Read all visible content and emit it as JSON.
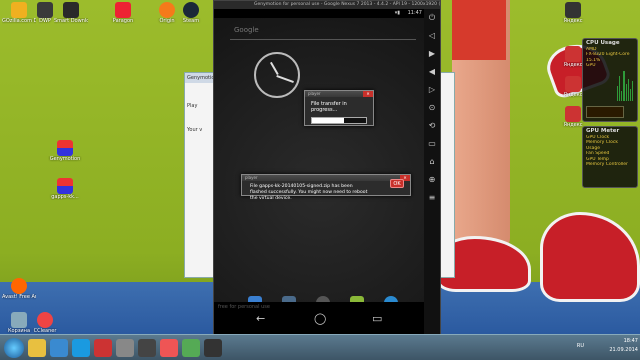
{
  "desktop": {
    "icons_left": [
      {
        "label": "GOzilla.com Download Ma...",
        "color": "#f0b020"
      },
      {
        "label": "DWP",
        "color": "#3a3a3a"
      },
      {
        "label": "Smart Download Manager",
        "color": "#2a2a2a"
      },
      {
        "label": "Paragon",
        "color": "#e23"
      },
      {
        "label": "Genymotion",
        "color": "#2a2a2a"
      },
      {
        "label": "gapps-kk...",
        "color": "#2a2a2a"
      },
      {
        "label": "gapps-kk...",
        "color": "#2a2a2a"
      },
      {
        "label": "Avast! Free Antivirus",
        "color": "#f60"
      },
      {
        "label": "Корзина",
        "color": "#8ab"
      },
      {
        "label": "CCleaner",
        "color": "#e44"
      }
    ],
    "icons_top": [
      {
        "label": "Origin",
        "color": "#f57a1a"
      },
      {
        "label": "Steam",
        "color": "#1b2838"
      }
    ],
    "icons_right": [
      {
        "label": "Яндекс",
        "color": "#333"
      },
      {
        "label": "Яндекс",
        "color": "#c33"
      },
      {
        "label": "Яндекс",
        "color": "#c33"
      },
      {
        "label": "Яндекс",
        "color": "#c33"
      }
    ]
  },
  "emulator": {
    "title": "Genymotion for personal use - Google Nexus 7 2013 - 4.4.2 - API 19 - 1200x1920 (1200x1920, 320dpi)",
    "status_time": "11:47",
    "search_placeholder": "Google",
    "watermark": "free for personal use",
    "nav": {
      "back": "←",
      "home": "◯",
      "recent": "▭"
    },
    "side_controls": [
      "⏻",
      "◁",
      "▶",
      "◀",
      "▷",
      "⊙",
      "⟲",
      "▭",
      "⌂",
      "⊕",
      "≡"
    ]
  },
  "progress_dialog": {
    "bar_title": "player",
    "message": "File transfer in progress...",
    "progress": 0.6
  },
  "done_dialog": {
    "bar_title": "player",
    "message": "File gapps-kk-20140105-signed.zip has been flashed successfully. You might now need to reboot the virtual device.",
    "ok_label": "OK"
  },
  "bg_window": {
    "title": "Genymotion",
    "play_label": "Play",
    "text": "Your v"
  },
  "gadgets": {
    "cpu": {
      "title": "CPU Usage",
      "lines": [
        "AMD",
        "FX-8320 Eight-Core",
        "15.1%",
        "GPU"
      ]
    },
    "gpu": {
      "title": "GPU Meter",
      "lines": [
        "GPU Clock",
        "Memory Clock",
        "Usage",
        "Fan Speed",
        "GPU Temp",
        "Memory Controller"
      ]
    }
  },
  "taskbar": {
    "time": "18:47",
    "date": "21.09.2014",
    "lang": "RU"
  },
  "colors": {
    "accent_red": "#c8302a",
    "cpu_green": "#2f9a3a"
  }
}
